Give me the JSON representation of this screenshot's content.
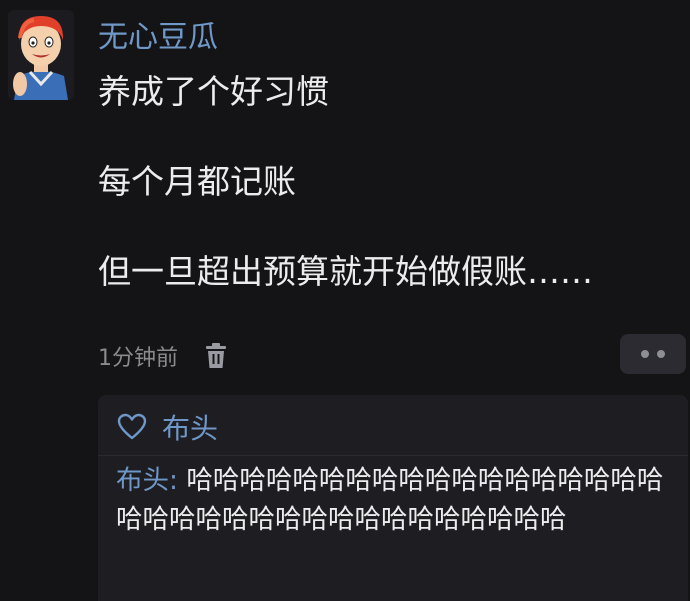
{
  "post": {
    "username": "无心豆瓜",
    "lines": [
      "养成了个好习惯",
      "每个月都记账",
      "但一旦超出预算就开始做假账……"
    ],
    "time": "1分钟前"
  },
  "icons": {
    "delete": "trash-icon",
    "more": "more-dots-icon",
    "like": "heart-outline-icon"
  },
  "likes": {
    "names": "布头"
  },
  "comment": {
    "author": "布头",
    "separator": ": ",
    "text": "哈哈哈哈哈哈哈哈哈哈哈哈哈哈哈哈哈哈哈哈哈哈哈哈哈哈哈哈哈哈哈哈哈哈哈"
  },
  "colors": {
    "background": "#141416",
    "link": "#6f97c8",
    "panel": "#1e1e22",
    "muted": "#8a8a8f"
  }
}
